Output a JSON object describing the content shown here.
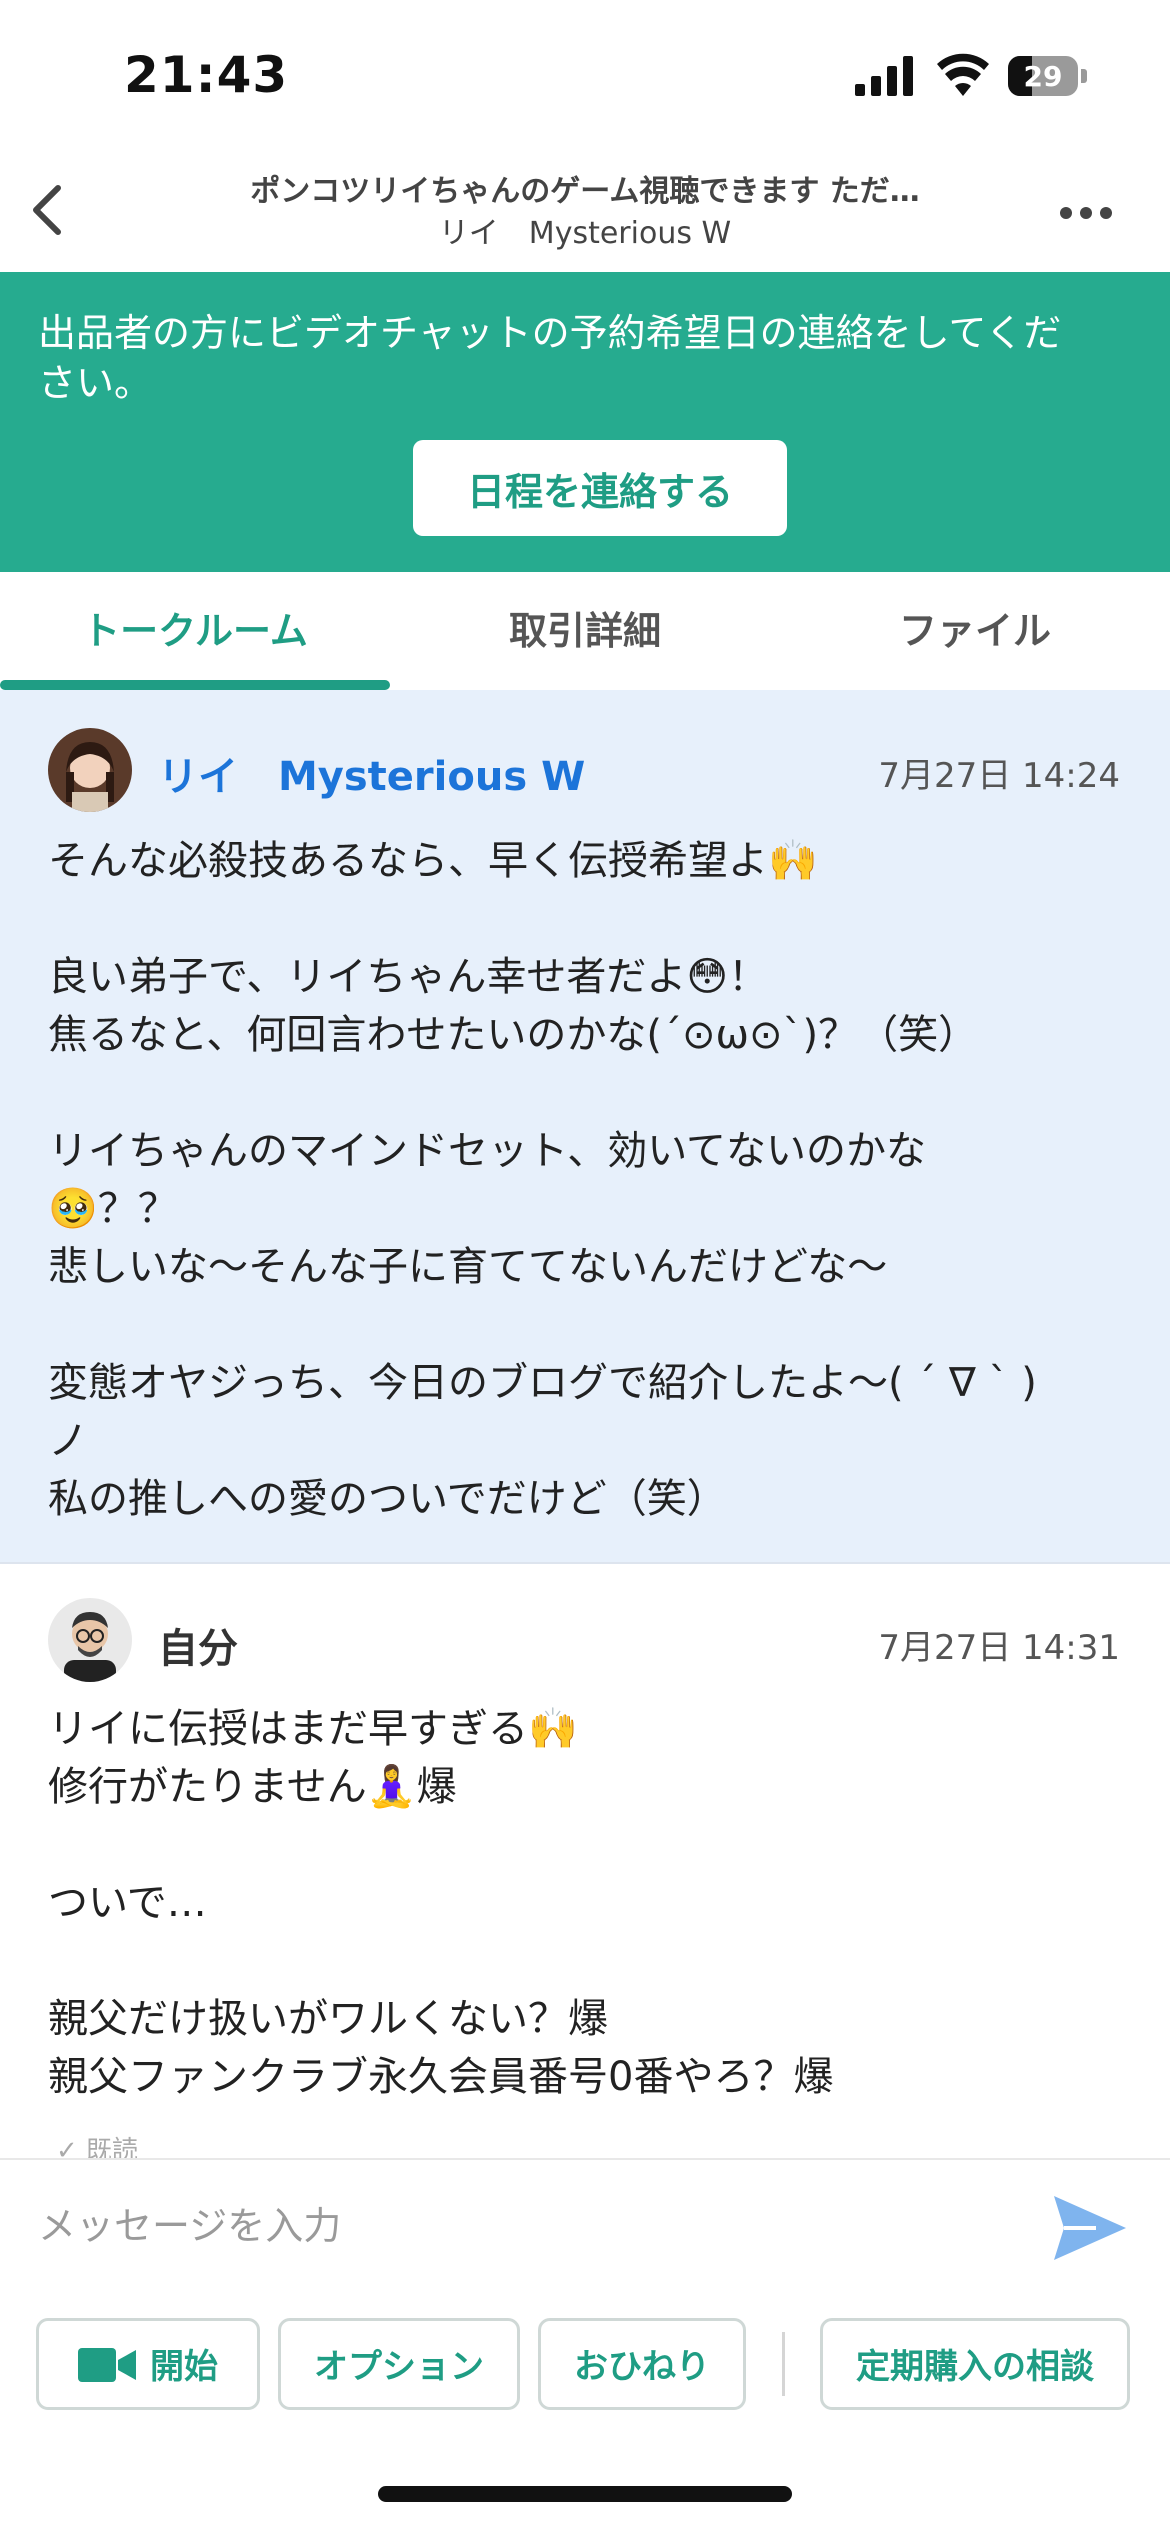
{
  "status_bar": {
    "time": "21:43",
    "battery": "29"
  },
  "header": {
    "title": "ポンコツリイちゃんのゲーム視聴できます ただ…",
    "subtitle": "リイ　Mysterious W"
  },
  "banner": {
    "text": "出品者の方にビデオチャットの予約希望日の連絡をしてください。",
    "button": "日程を連絡する"
  },
  "tabs": [
    {
      "label": "トークルーム",
      "active": true
    },
    {
      "label": "取引詳細",
      "active": false
    },
    {
      "label": "ファイル",
      "active": false
    }
  ],
  "messages": [
    {
      "sender": "リイ　Mysterious W",
      "timestamp": "7月27日 14:24",
      "text": "そんな必殺技あるなら、早く伝授希望よ🙌\n\n良い弟子で、リイちゃん幸せ者だよ😳！\n焦るなと、何回言わせたいのかな(´⊙ω⊙`)？（笑）\n\nリイちゃんのマインドセット、効いてないのかな\n🥹？？\n悲しいな〜そんな子に育ててないんだけどな〜\n\n変態オヤジっち、今日のブログで紹介したよ〜( ´ ∇ ` )\nノ\n私の推しへの愛のついでだけど（笑）"
    },
    {
      "sender": "自分",
      "timestamp": "7月27日 14:31",
      "text": "リイに伝授はまだ早すぎる🙌\n修行がたりません🧘‍♀️爆\n\nついで…\n\n親父だけ扱いがワルくない？爆\n親父ファンクラブ永久会員番号0番やろ？爆",
      "read_status": "✓ 既読"
    }
  ],
  "composer": {
    "placeholder": "メッセージを入力",
    "buttons": {
      "start": "開始",
      "option": "オプション",
      "tip": "おひねり",
      "subscription": "定期購入の相談"
    }
  },
  "colors": {
    "accent": "#26ab8f",
    "link_blue": "#1c74d9",
    "message_bg": "#e7f0fb"
  }
}
